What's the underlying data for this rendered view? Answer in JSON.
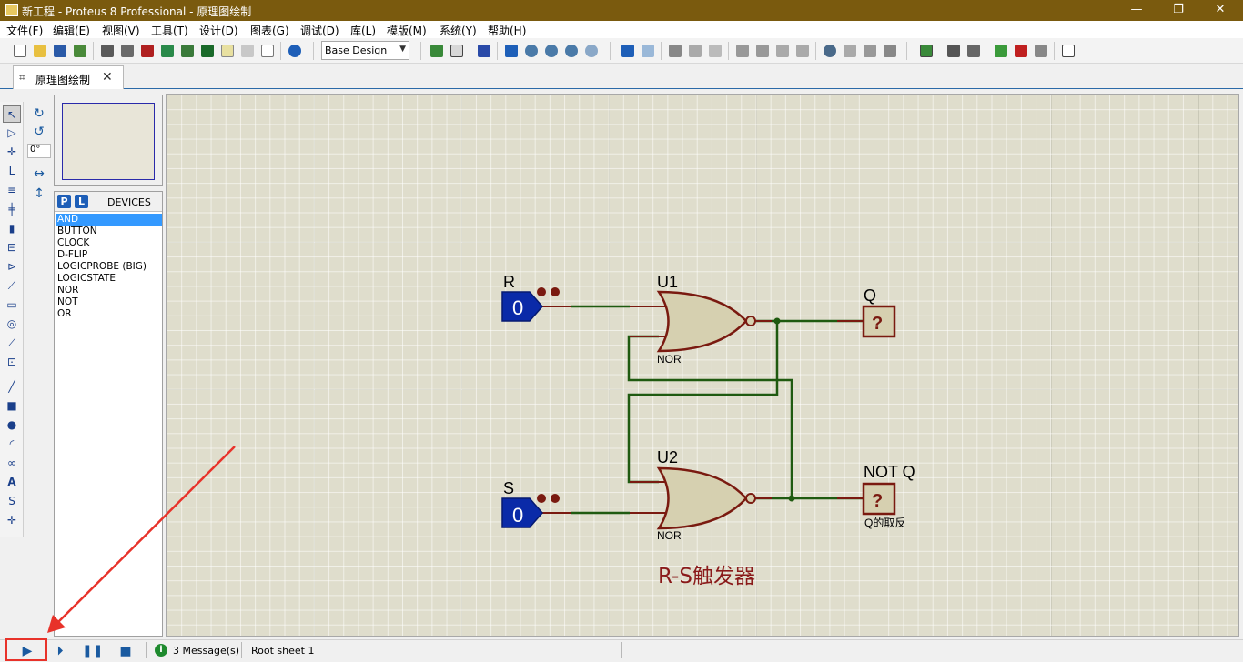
{
  "window": {
    "title": "新工程 - Proteus 8 Professional - 原理图绘制"
  },
  "menu": {
    "items": [
      "文件(F)",
      "编辑(E)",
      "视图(V)",
      "工具(T)",
      "设计(D)",
      "图表(G)",
      "调试(D)",
      "库(L)",
      "模版(M)",
      "系统(Y)",
      "帮助(H)"
    ]
  },
  "toolbar": {
    "design_select": "Base Design"
  },
  "tab": {
    "label": "原理图绘制"
  },
  "mode_panel": {
    "angle": "0°"
  },
  "devices": {
    "p_label": "P",
    "l_label": "L",
    "title": "DEVICES",
    "items": [
      "AND",
      "BUTTON",
      "CLOCK",
      "D-FLIP",
      "LOGICPROBE (BIG)",
      "LOGICSTATE",
      "NOR",
      "NOT",
      "OR"
    ],
    "selected": "AND"
  },
  "schematic": {
    "input_r": {
      "label": "R",
      "value": "0"
    },
    "input_s": {
      "label": "S",
      "value": "0"
    },
    "gate_u1": {
      "ref": "U1",
      "type": "NOR"
    },
    "gate_u2": {
      "ref": "U2",
      "type": "NOR"
    },
    "probe_q": {
      "label": "Q",
      "value": "?"
    },
    "probe_notq": {
      "label": "NOT Q",
      "value": "?",
      "note": "Q的取反"
    },
    "title_text": "R-S触发器",
    "colors": {
      "wire": "#1f5a10",
      "pin": "#7a1a10",
      "gate_fill": "#d6d0b0",
      "logicstate": "#0a2aa8",
      "probe": "#7a1a10"
    }
  },
  "status": {
    "messages": "3 Message(s)",
    "sheet": "Root sheet 1"
  }
}
